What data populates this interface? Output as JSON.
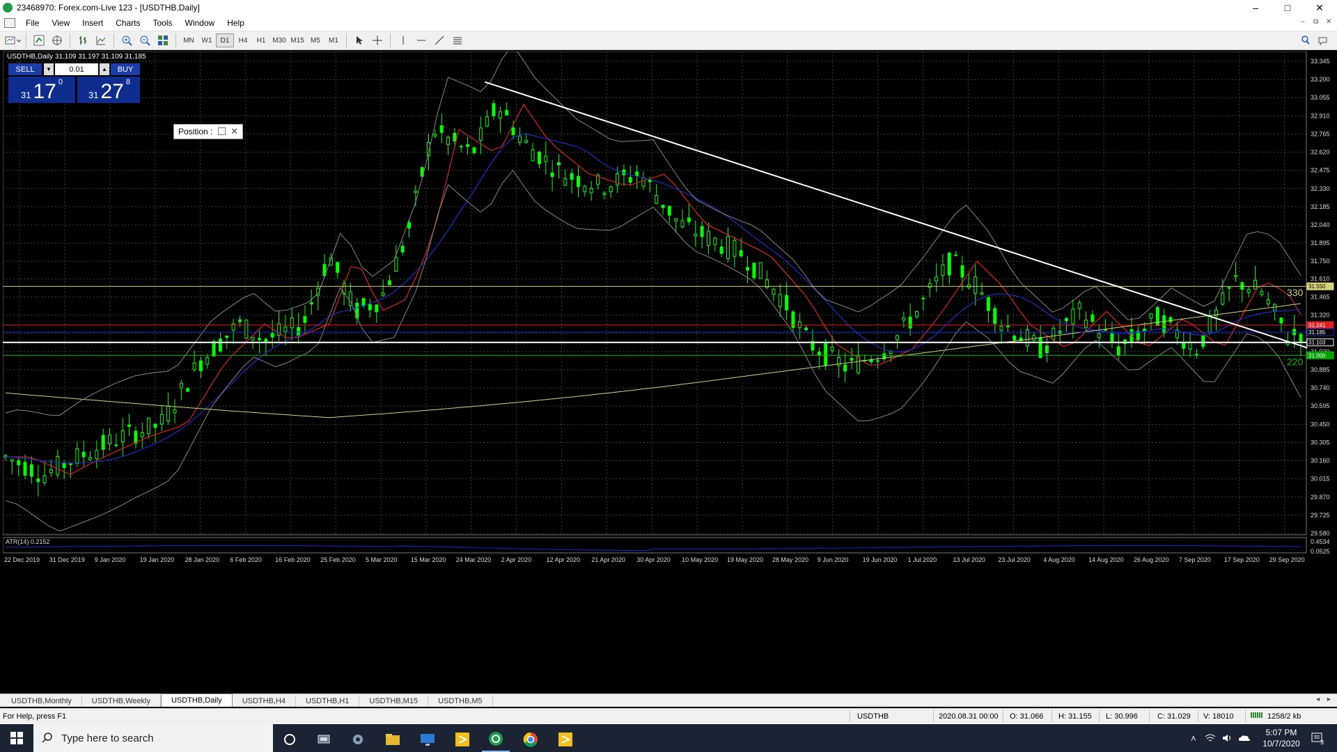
{
  "window": {
    "title": "23468970: Forex.com-Live 123 - [USDTHB,Daily]",
    "controls": [
      "–",
      "□",
      "✕"
    ],
    "mdi_controls": [
      "–",
      "⧉",
      "✕"
    ]
  },
  "menu": [
    "File",
    "View",
    "Insert",
    "Charts",
    "Tools",
    "Window",
    "Help"
  ],
  "toolbar": {
    "timeframes": [
      "MN",
      "W1",
      "D1",
      "H4",
      "H1",
      "M30",
      "M15",
      "M5",
      "M1"
    ],
    "active_timeframe": "D1"
  },
  "chart": {
    "symbol_header": "USDTHB,Daily  31.109 31.197 31.109 31.185",
    "atr_label": "ATR(14) 0.2152",
    "price_axis": [
      "33.345",
      "33.200",
      "33.055",
      "32.910",
      "32.765",
      "32.620",
      "32.475",
      "32.330",
      "32.185",
      "32.040",
      "31.895",
      "31.750",
      "31.610",
      "31.465",
      "31.320",
      "31.175",
      "31.030",
      "30.885",
      "30.740",
      "30.595",
      "30.450",
      "30.305",
      "30.160",
      "30.015",
      "29.870",
      "29.725",
      "29.580"
    ],
    "atr_axis": [
      "0.4534",
      "0.0525"
    ],
    "date_axis": [
      "22 Dec 2019",
      "31 Dec 2019",
      "9 Jan 2020",
      "19 Jan 2020",
      "28 Jan 2020",
      "6 Feb 2020",
      "16 Feb 2020",
      "25 Feb 2020",
      "5 Mar 2020",
      "15 Mar 2020",
      "24 Mar 2020",
      "2 Apr 2020",
      "12 Apr 2020",
      "21 Apr 2020",
      "30 Apr 2020",
      "10 May 2020",
      "19 May 2020",
      "28 May 2020",
      "9 Jun 2020",
      "19 Jun 2020",
      "1 Jul 2020",
      "13 Jul 2020",
      "23 Jul 2020",
      "4 Aug 2020",
      "14 Aug 2020",
      "26 Aug 2020",
      "7 Sep 2020",
      "17 Sep 2020",
      "29 Sep 2020"
    ],
    "price_tags": {
      "yellow_line": "31.550",
      "red_line": "31.241",
      "blue_line": "31.185",
      "white_line": "31.103",
      "green_line": "31.000"
    },
    "line_labels": {
      "yellow": "330",
      "green": "220"
    },
    "colors": {
      "background": "#000000",
      "grid": "#2a4a2a",
      "candle": "#00ff00",
      "yellow": "#d6d27a",
      "red": "#e02020",
      "blue": "#1e2ccf",
      "trendline": "#ffffff",
      "green_level": "#00c000"
    }
  },
  "one_click": {
    "sell": "SELL",
    "buy": "BUY",
    "lot": "0.01",
    "sell_price_small": "31",
    "sell_price_big": "17",
    "sell_price_sup": "0",
    "buy_price_small": "31",
    "buy_price_big": "27",
    "buy_price_sup": "8"
  },
  "position_box": {
    "label": "Position :"
  },
  "tabs": [
    "USDTHB,Monthly",
    "USDTHB,Weekly",
    "USDTHB,Daily",
    "USDTHB,H4",
    "USDTHB,H1",
    "USDTHB,M15",
    "USDTHB,M5"
  ],
  "active_tab": "USDTHB,Daily",
  "status": {
    "help": "For Help, press F1",
    "symbol": "USDTHB",
    "datetime": "2020.08.31 00:00",
    "open": "O: 31.066",
    "high": "H: 31.155",
    "low": "L: 30.996",
    "close": "C: 31.029",
    "volume": "V: 18010",
    "traffic": "1258/2 kb"
  },
  "taskbar": {
    "search_placeholder": "Type here to search",
    "time": "5:07 PM",
    "date": "10/7/2020",
    "notifications": "3"
  }
}
